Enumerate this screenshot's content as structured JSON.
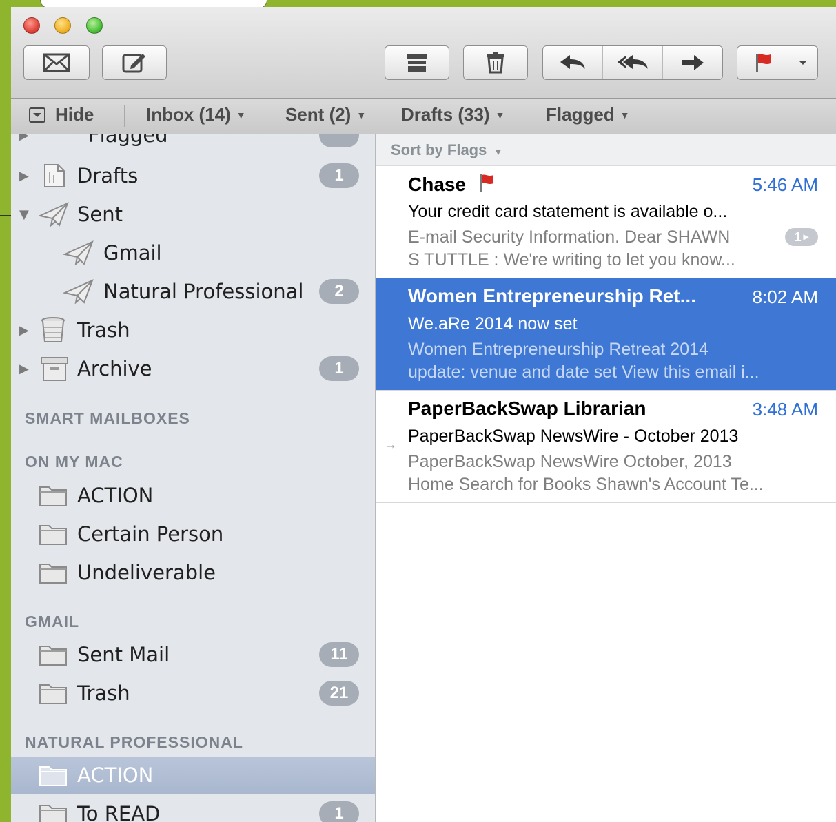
{
  "favorites_bar": {
    "hide": "Hide",
    "inbox": "Inbox (14)",
    "sent": "Sent (2)",
    "drafts": "Drafts (33)",
    "flagged": "Flagged"
  },
  "sidebar": {
    "partial_item": {
      "label": "Flagged"
    },
    "mailboxes": [
      {
        "label": "Drafts",
        "badge": "1"
      },
      {
        "label": "Sent"
      },
      {
        "label": "Gmail"
      },
      {
        "label": "Natural Professional",
        "badge": "2"
      },
      {
        "label": "Trash"
      },
      {
        "label": "Archive",
        "badge": "1"
      }
    ],
    "smart_mailboxes_header": "SMART MAILBOXES",
    "on_my_mac_header": "ON MY MAC",
    "on_my_mac": [
      {
        "label": "ACTION"
      },
      {
        "label": "Certain Person"
      },
      {
        "label": "Undeliverable"
      }
    ],
    "gmail_header": "GMAIL",
    "gmail": [
      {
        "label": "Sent Mail",
        "badge": "11"
      },
      {
        "label": "Trash",
        "badge": "21"
      }
    ],
    "natural_professional_header": "NATURAL PROFESSIONAL",
    "natural_professional": [
      {
        "label": "ACTION",
        "selected": true
      },
      {
        "label": "To READ",
        "badge": "1"
      }
    ]
  },
  "message_list": {
    "sort_label": "Sort by Flags",
    "messages": [
      {
        "sender": "Chase",
        "flagged": true,
        "time": "5:46 AM",
        "subject": "Your credit card statement is available o...",
        "preview_line1": "E-mail Security Information. Dear SHAWN",
        "preview_line2": "S TUTTLE : We're writing to let you know...",
        "thread_count": "1"
      },
      {
        "sender": "Women Entrepreneurship Ret...",
        "time": "8:02 AM",
        "subject": "We.aRe 2014 now set",
        "preview_line1": "Women Entrepreneurship Retreat 2014",
        "preview_line2": "update: venue and date set View this email i...",
        "selected": true
      },
      {
        "sender": "PaperBackSwap Librarian",
        "time": "3:48 AM",
        "subject": "PaperBackSwap NewsWire - October 2013",
        "preview_line1": "PaperBackSwap NewsWire October, 2013",
        "preview_line2": "Home Search for Books Shawn's Account Te...",
        "replied": true
      }
    ]
  },
  "colors": {
    "slide_background": "#8fb52e",
    "selection_blue": "#3e78d4",
    "time_blue": "#2f6fd6",
    "flag_red": "#d62a22",
    "badge_gray": "#a6adb7"
  },
  "icons": {
    "toolbar": [
      "envelope-icon",
      "compose-icon",
      "archive-icon",
      "trash-icon",
      "reply-icon",
      "reply-all-icon",
      "forward-icon",
      "flag-icon",
      "chevron-down-icon"
    ]
  }
}
